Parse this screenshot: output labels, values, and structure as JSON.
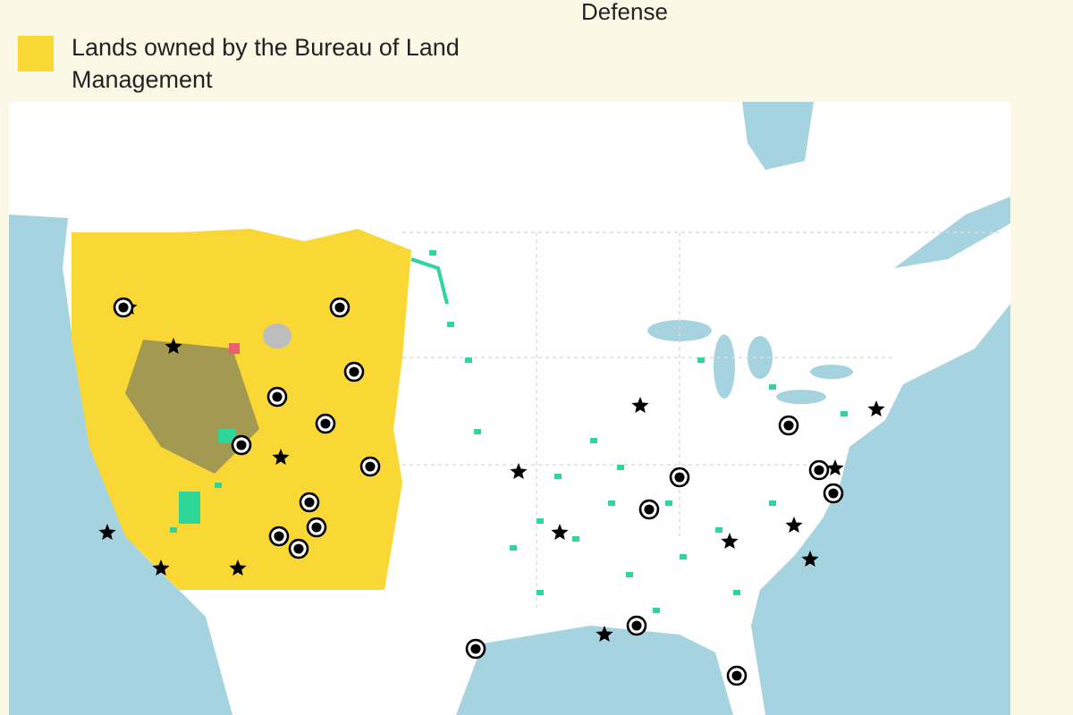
{
  "top_label": "Defense",
  "legend": [
    {
      "label": "Lands owned by the Bureau of Land Management",
      "color": "#f9d835"
    }
  ]
}
